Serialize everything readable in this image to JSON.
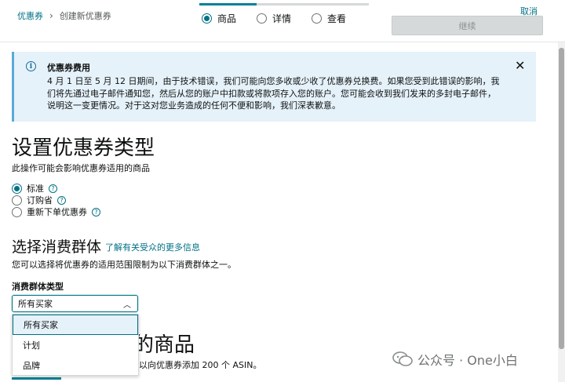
{
  "header": {
    "breadcrumb": [
      "优惠券",
      "创建新优惠券"
    ],
    "breadcrumb_sep": "›",
    "steps": [
      {
        "label": "商品",
        "checked": true
      },
      {
        "label": "详情",
        "checked": false
      },
      {
        "label": "查看",
        "checked": false
      }
    ],
    "progress_fraction": 0.33,
    "cancel_label": "取消",
    "continue_label": "继续"
  },
  "alert": {
    "icon": "info-icon",
    "title": "优惠券费用",
    "body": "4 月 1 日至 5 月 12 日期间，由于技术错误，我们可能向您多收或少收了优惠券兑换费。如果您受到此错误的影响，我们将先通过电子邮件通知您，然后从您的账户中扣款或将款项存入您的账户。您可能会收到我们发来的多封电子邮件，说明这一变更情况。对于这对您业务造成的任何不便和影响，我们深表歉意。",
    "close_glyph": "✕"
  },
  "coupon_type": {
    "heading": "设置优惠券类型",
    "subtext": "此操作可能会影响优惠券适用的商品",
    "options": [
      {
        "label": "标准",
        "checked": true
      },
      {
        "label": "订购省",
        "checked": false
      },
      {
        "label": "重新下单优惠券",
        "checked": false
      }
    ]
  },
  "audience": {
    "heading": "选择消费群体",
    "link": "了解有关受众的更多信息",
    "subtext": "您可以选择将优惠券的适用范围限制为以下消费群体之一。",
    "field_label": "消费群体类型",
    "selected": "所有买家",
    "options": [
      "所有买家",
      "计划",
      "品牌"
    ]
  },
  "products": {
    "heading_partial": "的商品",
    "subtext_partial": "以向优惠券添加 200 个 ASIN。"
  },
  "watermark": {
    "text": "公众号 · One小白"
  },
  "colors": {
    "accent": "#007185",
    "alert_bg": "#e6f2fa",
    "button_disabled": "#d5d9d9"
  }
}
